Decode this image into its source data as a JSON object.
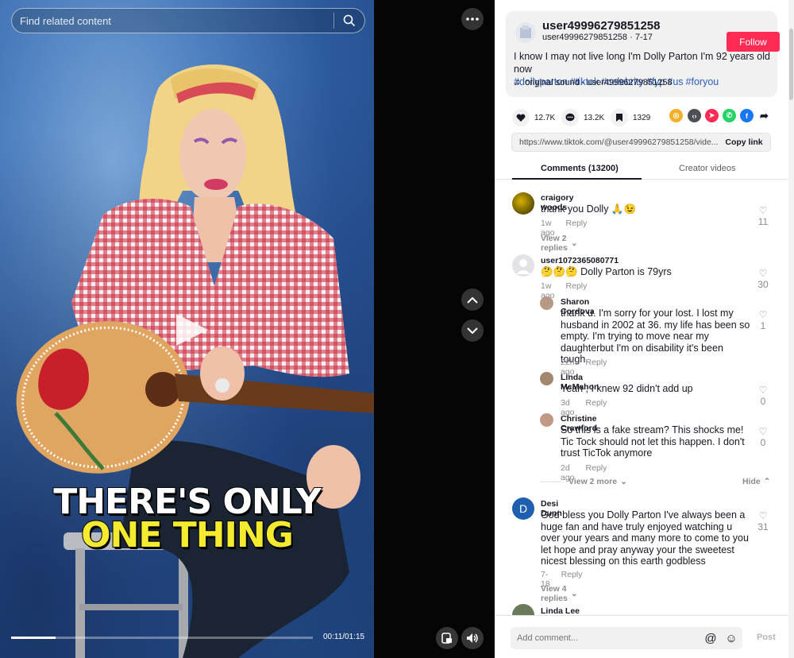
{
  "search": {
    "placeholder": "Find related content"
  },
  "video": {
    "caption_line1": "THERE'S ONLY",
    "caption_line2": "ONE THING",
    "time": "00:11/01:15",
    "progress": 0.147
  },
  "post": {
    "username": "user49996279851258",
    "handle_date": "user49996279851258 · 7-17",
    "follow_label": "Follow",
    "description": "I know I may not live long I'm Dolly Parton I'm 92 years old now",
    "hashtags": [
      "#dollyparton",
      "#tiktok",
      "#celebrity",
      "#fyp",
      "#us",
      "#foryou"
    ],
    "sound": "original sound - user49996279851258"
  },
  "stats": {
    "likes": "12.7K",
    "comments": "13.2K",
    "saves": "1329"
  },
  "share_icons": [
    "tiktok-friends-icon",
    "embed-icon",
    "send-icon",
    "whatsapp-icon",
    "facebook-icon",
    "share-arrow-icon"
  ],
  "link": {
    "url": "https://www.tiktok.com/@user49996279851258/vide...",
    "copy_label": "Copy link"
  },
  "tabs": {
    "comments": "Comments (13200)",
    "creator": "Creator videos"
  },
  "comments": [
    {
      "name": "craigory woods",
      "text": "thank you Dolly 🙏😉",
      "time": "1w ago",
      "reply": "Reply",
      "likes": "11",
      "view_replies": "View 2 replies"
    },
    {
      "name": "user1072365080771",
      "text": "🤔🤔🤔 Dolly Parton is 79yrs",
      "time": "1w ago",
      "reply": "Reply",
      "likes": "30",
      "replies": [
        {
          "name": "Sharon Cordova",
          "text": "thank u. I'm sorry for your lost. I lost my husband in 2002 at 36. my life has been so empty. I'm trying to move near my daughterbut I'm on disability it's been tough.",
          "time": "22h ago",
          "reply": "Reply",
          "likes": "1"
        },
        {
          "name": "Linda McMahon",
          "text": "Yeah , I knew 92 didn't add up",
          "time": "3d ago",
          "reply": "Reply",
          "likes": "0"
        },
        {
          "name": "Christine Crawford",
          "text": "So this is a fake stream? This shocks me! Tic Tock should not let this happen. I don't trust TicTok anymore",
          "time": "2d ago",
          "reply": "Reply",
          "likes": "0"
        }
      ],
      "view_more": "View 2 more",
      "hide": "Hide"
    },
    {
      "name": "Desi Dunn",
      "avatar_letter": "D",
      "text": "God bless you Dolly Parton I've always been a huge fan and have truly enjoyed watching u over your years and many more to come to you let hope and pray anyway your the sweetest nicest blessing on this earth godbless",
      "time": "7-18",
      "reply": "Reply",
      "likes": "31",
      "view_replies": "View 4 replies"
    },
    {
      "name": "Linda Lee Blevins-hartbarger"
    }
  ],
  "composer": {
    "placeholder": "Add comment...",
    "post_label": "Post"
  },
  "colors": {
    "accent": "#fe2c55",
    "hashtag": "#2b5db9",
    "avatar_blue": "#1f5fb0"
  }
}
